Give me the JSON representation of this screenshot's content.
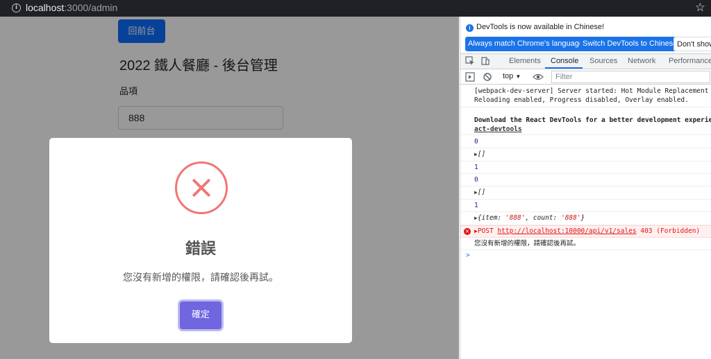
{
  "browser": {
    "url_host": "localhost",
    "url_rest": ":3000/admin"
  },
  "page": {
    "back_button": "回前台",
    "title": "2022 鐵人餐廳 - 後台管理",
    "item_label": "品項",
    "item_value": "888"
  },
  "modal": {
    "title": "錯誤",
    "message": "您沒有新增的權限，請確認後再試。",
    "confirm_button": "確定"
  },
  "devtools": {
    "infobar_message": "DevTools is now available in Chinese!",
    "btn_match_language": "Always match Chrome's language",
    "btn_switch": "Switch DevTools to Chinese",
    "btn_dont_show": "Don't show",
    "tabs": [
      "Elements",
      "Console",
      "Sources",
      "Network",
      "Performance"
    ],
    "active_tab": "Console",
    "context": "top",
    "filter_placeholder": "Filter",
    "logs": {
      "webpack_1": "[webpack-dev-server] Server started: Hot Module Replacement e",
      "webpack_2": "Reloading enabled, Progress disabled, Overlay enabled.",
      "react_1": "Download the React DevTools for a better development experien",
      "react_2": "act-devtools",
      "v0a": "0",
      "arr1": "[]",
      "v1a": "1",
      "v0b": "0",
      "arr2": "[]",
      "v1b": "1",
      "obj_open": "{item: ",
      "obj_item": "'888'",
      "obj_mid": ", count: ",
      "obj_count": "'888'",
      "obj_close": "}",
      "err_method": "POST ",
      "err_url": "http://localhost:10000/api/v1/sales",
      "err_status": " 403 (Forbidden)",
      "msg": "您沒有新增的權限，請確認後再試。",
      "prompt": ">"
    }
  }
}
